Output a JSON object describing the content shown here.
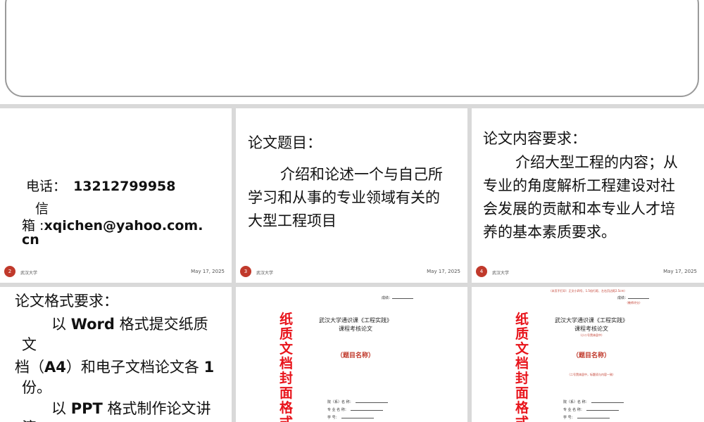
{
  "top_slide": {},
  "footer": {
    "org": "武汉大学",
    "date": "May 17, 2025"
  },
  "slide2": {
    "num": "2",
    "phone_label": "电话：",
    "phone_value": "13212799958",
    "email_label_1": "信",
    "email_label_2": "箱 :",
    "email_value_1": "xqichen@yahoo.com.",
    "email_value_2": "cn"
  },
  "slide3": {
    "num": "3",
    "heading": "论文题目：",
    "lines": [
      "介绍和论述一个与自己所",
      "学习和从事的专业领域有关的",
      "大型工程项目"
    ]
  },
  "slide4": {
    "num": "4",
    "heading": "论文内容要求：",
    "lines": [
      "介绍大型工程的内容；从",
      "专业的角度解析工程建设对社",
      "会发展的贡献和本专业人才培",
      "养的基本素质要求。"
    ]
  },
  "slide5": {
    "heading": "论文格式要求：",
    "line1_pre": "以 ",
    "line1_bold": "Word",
    "line1_post": " 格式提交纸质",
    "line2": "文",
    "line3_a": "档（",
    "line3_b": "A4",
    "line3_c": "）和电子文档论文各 ",
    "line3_d": "1",
    "line4": "份。",
    "line5_pre": "以 ",
    "line5_bold": "PPT",
    "line5_post": " 格式制作论文讲",
    "line6": "演"
  },
  "slide6": {
    "vertical": "纸质文档封面格式",
    "score": "成绩：",
    "title1": "武汉大学通识课《工程实践》",
    "title2": "课程考核论文",
    "subtitle": "（题目名称）",
    "fields": [
      "院（系）名 称：",
      "专 业 名 称：",
      "学 号："
    ]
  },
  "slide7": {
    "vertical": "纸质文档封面格式",
    "header_note": "（本页不打印：正文小四号、1.5倍行距、左右页边距2.5cm）",
    "score": "成绩：",
    "score_note": "（教师评分）",
    "title1": "武汉大学通识课《工程实践》",
    "title2": "课程考核论文",
    "title_note": "（小二号黑体居中）",
    "subtitle": "（题目名称）",
    "mid_note": "（二号黑体居中，标题须与内容一致）",
    "fields": [
      "院（系）名 称：",
      "专 业 名 称：",
      "学 号："
    ]
  }
}
